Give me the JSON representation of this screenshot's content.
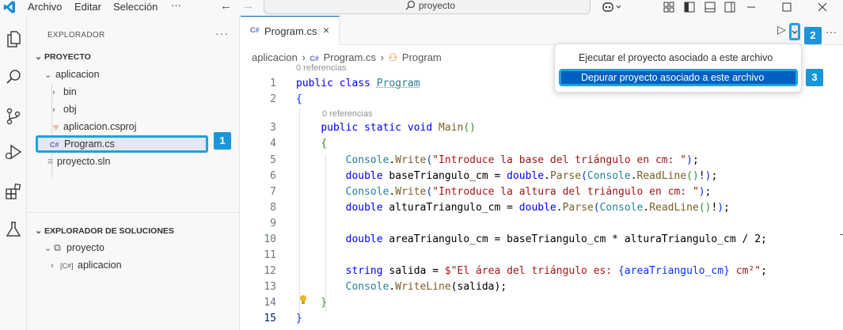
{
  "titlebar": {
    "menus": [
      "Archivo",
      "Editar",
      "Selección",
      "···"
    ],
    "search_text": "proyecto"
  },
  "activity_bar": {
    "icons": [
      "files-icon",
      "search-icon",
      "source-control-icon",
      "run-debug-icon",
      "extensions-icon",
      "testing-icon"
    ]
  },
  "explorer": {
    "title": "EXPLORADOR",
    "more": "···",
    "section": "PROYECTO",
    "items": [
      {
        "label": "aplicacion",
        "type": "folder-open"
      },
      {
        "label": "bin",
        "type": "folder"
      },
      {
        "label": "obj",
        "type": "folder"
      },
      {
        "label": "aplicacion.csproj",
        "type": "rss-file"
      },
      {
        "label": "Program.cs",
        "type": "cs-file"
      },
      {
        "label": "proyecto.sln",
        "type": "file"
      }
    ],
    "solutions_title": "EXPLORADOR DE SOLUCIONES",
    "solutions_items": [
      {
        "label": "proyecto"
      },
      {
        "label": "aplicacion"
      }
    ]
  },
  "editor": {
    "tab": {
      "icon": "C#",
      "label": "Program.cs",
      "close": "×"
    },
    "more": "···",
    "breadcrumb": [
      "aplicacion",
      "›",
      "Program.cs",
      "›",
      "Program"
    ],
    "codelens": [
      "0 referencias",
      "0 referencias"
    ],
    "line_numbers": [
      "1",
      "2",
      "3",
      "4",
      "5",
      "6",
      "7",
      "8",
      "9",
      "10",
      "11",
      "12",
      "13",
      "14",
      "15"
    ],
    "lines": {
      "l1_kw1": "public",
      "l1_kw2": "class",
      "l1_name": "Program",
      "l2": "{",
      "l3_kw1": "public",
      "l3_kw2": "static",
      "l3_kw3": "void",
      "l3_fn": "Main",
      "l3_p": "()",
      "l4": "{",
      "l5_t": "Console",
      "l5_fn": "Write",
      "l5_str": "\"Introduce la base del triángulo en cm: \"",
      "l6_kw": "double",
      "l6_var": "baseTriangulo_cm",
      "l6_kw2": "double",
      "l6_fn": "Parse",
      "l6_t": "Console",
      "l6_fn2": "ReadLine",
      "l7_t": "Console",
      "l7_fn": "Write",
      "l7_str": "\"Introduce la altura del triángulo en cm: \"",
      "l8_kw": "double",
      "l8_var": "alturaTriangulo_cm",
      "l8_kw2": "double",
      "l8_fn": "Parse",
      "l8_t": "Console",
      "l8_fn2": "ReadLine",
      "l10_kw": "double",
      "l10_rest": " areaTriangulo_cm = baseTriangulo_cm * alturaTriangulo_cm / 2;",
      "l12_kw": "string",
      "l12_mid": " salida = ",
      "l12_str1": "$\"El área del triángulo es: ",
      "l12_interp": "{areaTriangulo_cm}",
      "l12_str2": " cm²\"",
      "l13_t": "Console",
      "l13_fn": "WriteLine",
      "l13_rest": "(salida);",
      "l14": "}",
      "l15": "}"
    }
  },
  "menu": {
    "option1": "Ejecutar el proyecto asociado a este archivo",
    "option2": "Depurar proyecto asociado a este archivo"
  },
  "callouts": [
    "1",
    "2",
    "3"
  ],
  "colors": {
    "accent": "#1ea0e0",
    "highlight": "#0060c0",
    "badge": "#1a95d9"
  }
}
